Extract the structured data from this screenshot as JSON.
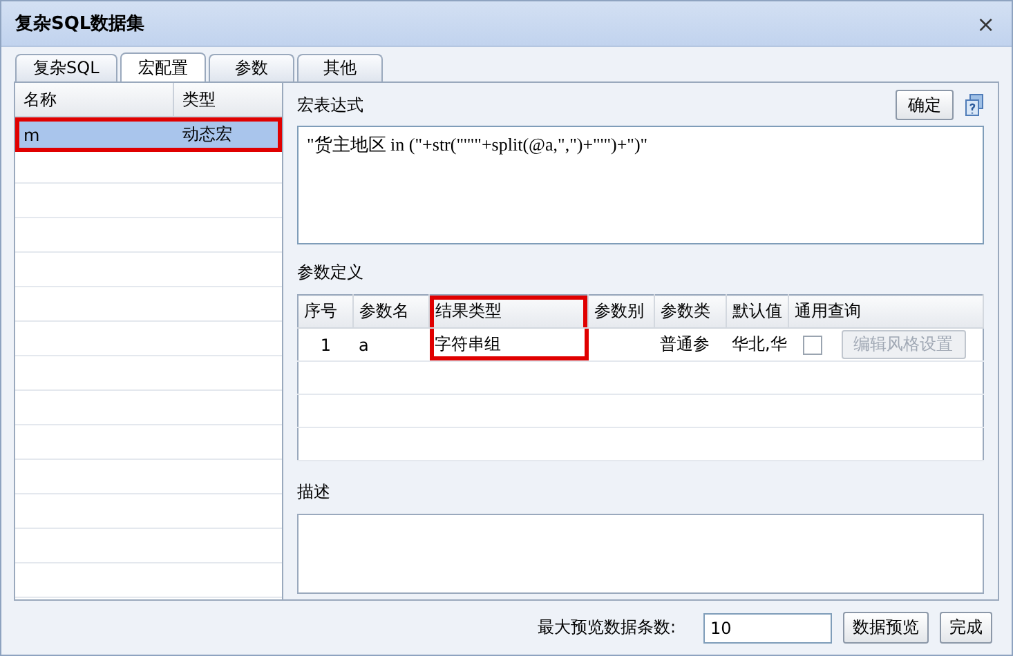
{
  "window": {
    "title": "复杂SQL数据集",
    "close": "×"
  },
  "tabs": [
    {
      "label": "复杂SQL",
      "selected": false
    },
    {
      "label": "宏配置",
      "selected": true
    },
    {
      "label": "参数",
      "selected": false
    },
    {
      "label": "其他",
      "selected": false
    }
  ],
  "macro_list": {
    "columns": [
      "名称",
      "类型"
    ],
    "rows": [
      {
        "name": "m",
        "type": "动态宏",
        "selected": true,
        "highlighted": true
      }
    ]
  },
  "macro_expression": {
    "label": "宏表达式",
    "confirm_button": "确定",
    "value": "\"货主地区 in (\"+str(\"'\"\"+split(@a,\",\")+\"'\")+\")\""
  },
  "parameters": {
    "label": "参数定义",
    "columns": [
      {
        "label": "序号",
        "highlighted": false
      },
      {
        "label": "参数名",
        "highlighted": false
      },
      {
        "label": "结果类型",
        "highlighted": true
      },
      {
        "label": "参数别",
        "highlighted": false
      },
      {
        "label": "参数类",
        "highlighted": false
      },
      {
        "label": "默认值",
        "highlighted": false
      },
      {
        "label": "通用查询",
        "highlighted": false
      }
    ],
    "rows": [
      {
        "index": "1",
        "name": "a",
        "result_type": "字符串组",
        "alias": "",
        "param_type": "普通参",
        "default": "华北,华",
        "general_query": false,
        "style_button": "编辑风格设置",
        "style_button_disabled": true
      }
    ]
  },
  "description": {
    "label": "描述"
  },
  "footer": {
    "max_rows_label": "最大预览数据条数:",
    "max_rows_value": "10",
    "preview_button": "数据预览",
    "finish_button": "完成"
  }
}
